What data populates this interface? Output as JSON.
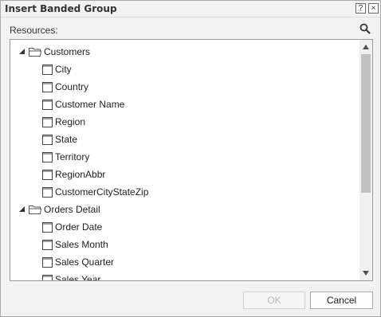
{
  "dialog": {
    "title": "Insert Banded Group",
    "help_glyph": "?",
    "close_glyph": "×"
  },
  "resources": {
    "label": "Resources:"
  },
  "tree": {
    "groups": [
      {
        "label": "Customers",
        "expanded": true,
        "fields": [
          "City",
          "Country",
          "Customer Name",
          "Region",
          "State",
          "Territory",
          "RegionAbbr",
          "CustomerCityStateZip"
        ]
      },
      {
        "label": "Orders Detail",
        "expanded": true,
        "fields": [
          "Order Date",
          "Sales Month",
          "Sales Quarter",
          "Sales Year"
        ]
      }
    ]
  },
  "buttons": {
    "ok": "OK",
    "cancel": "Cancel"
  },
  "colors": {
    "dialog_bg": "#f2f2f2",
    "tree_bg": "#ffffff",
    "scroll_thumb": "#c1c1c1",
    "disabled_text": "#b7b7b7"
  }
}
